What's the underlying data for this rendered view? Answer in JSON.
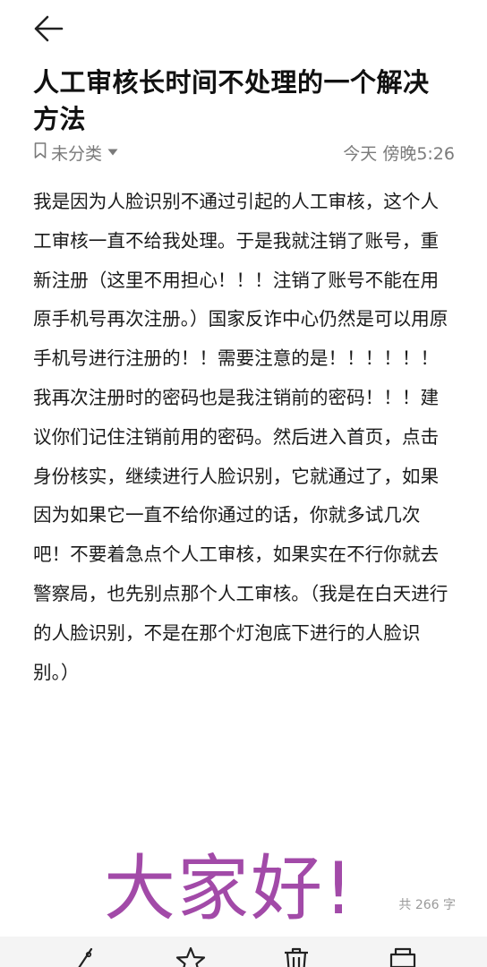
{
  "note": {
    "title": "人工审核长时间不处理的一个解决方法",
    "category": "未分类",
    "timestamp": "今天 傍晚5:26",
    "content": "我是因为人脸识别不通过引起的人工审核，这个人工审核一直不给我处理。于是我就注销了账号，重新注册（这里不用担心！！！注销了账号不能在用原手机号再次注册。）国家反诈中心仍然是可以用原手机号进行注册的！！需要注意的是！！！！！！我再次注册时的密码也是我注销前的密码！！！建议你们记住注销前用的密码。然后进入首页，点击身份核实，继续进行人脸识别，它就通过了，如果因为如果它一直不给你通过的话，你就多试几次吧！不要着急点个人工审核，如果实在不行你就去警察局，也先别点那个人工审核。（我是在白天进行的人脸识别，不是在那个灯泡底下进行的人脸识别。）",
    "word_count": "共 266 字"
  },
  "overlay": {
    "text": "大家好!"
  },
  "icons": {
    "back": "arrow-left-icon",
    "category": "bookmark-icon",
    "caret": "caret-down-icon",
    "toolbar": [
      "pen-icon",
      "star-icon",
      "trash-icon",
      "print-icon"
    ]
  },
  "colors": {
    "overlay_text": "#a24aa8",
    "meta_text": "#7a7a7a",
    "toolbar_bg": "#f4f4f4"
  }
}
